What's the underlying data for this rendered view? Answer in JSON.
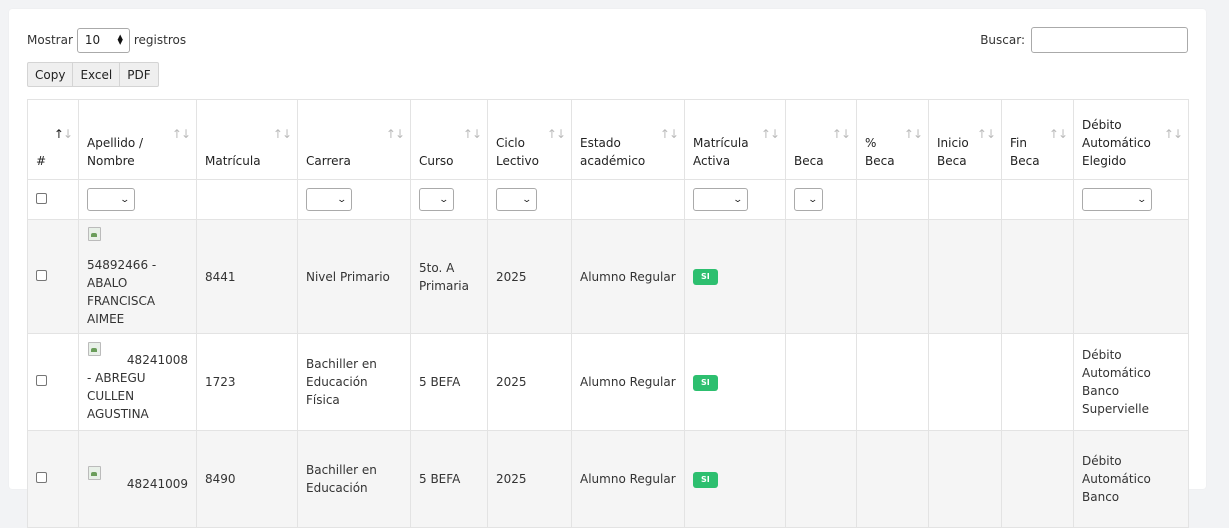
{
  "controls": {
    "show_label": "Mostrar",
    "length_value": "10",
    "records_label": "registros",
    "search_label": "Buscar:",
    "search_value": ""
  },
  "buttons": {
    "copy": "Copy",
    "excel": "Excel",
    "pdf": "PDF"
  },
  "columns": [
    {
      "l1": "",
      "l2": "#"
    },
    {
      "l1": "Apellido /",
      "l2": "Nombre"
    },
    {
      "l1": "",
      "l2": "Matrícula"
    },
    {
      "l1": "",
      "l2": "Carrera"
    },
    {
      "l1": "",
      "l2": "Curso"
    },
    {
      "l1": "Ciclo",
      "l2": "Lectivo"
    },
    {
      "l1": "Estado",
      "l2": "académico"
    },
    {
      "l1": "Matrícula",
      "l2": "Activa"
    },
    {
      "l1": "",
      "l2": "Beca"
    },
    {
      "l1": "%",
      "l2": "Beca"
    },
    {
      "l1": "Inicio",
      "l2": "Beca"
    },
    {
      "l1": "Fin",
      "l2": "Beca"
    },
    {
      "l1": "Débito",
      "l2": "Automático",
      "l3": "Elegido"
    }
  ],
  "rows": [
    {
      "name_l1": "54892466 -",
      "name_l2": "ABALO",
      "name_l3": "FRANCISCA AIMEE",
      "matricula": "8441",
      "carrera_l1": "Nivel Primario",
      "carrera_l2": "",
      "carrera_l3": "",
      "curso_l1": "5to. A",
      "curso_l2": "Primaria",
      "ciclo": "2025",
      "estado": "Alumno Regular",
      "activa": "SI",
      "debito_l1": "",
      "debito_l2": "",
      "debito_l3": "",
      "debito_l4": ""
    },
    {
      "name_l1": "48241008",
      "name_l2": "- ABREGU CULLEN",
      "name_l3": "AGUSTINA",
      "matricula": "1723",
      "carrera_l1": "Bachiller en",
      "carrera_l2": "Educación",
      "carrera_l3": "Física",
      "curso_l1": "5 BEFA",
      "curso_l2": "",
      "ciclo": "2025",
      "estado": "Alumno Regular",
      "activa": "SI",
      "debito_l1": "Débito",
      "debito_l2": "Automático",
      "debito_l3": "Banco",
      "debito_l4": "Supervielle"
    },
    {
      "name_l1": "48241009",
      "name_l2": "",
      "name_l3": "",
      "matricula": "8490",
      "carrera_l1": "Bachiller en",
      "carrera_l2": "Educación",
      "carrera_l3": "",
      "curso_l1": "5 BEFA",
      "curso_l2": "",
      "ciclo": "2025",
      "estado": "Alumno Regular",
      "activa": "SI",
      "debito_l1": "Débito",
      "debito_l2": "Automático",
      "debito_l3": "Banco",
      "debito_l4": ""
    }
  ],
  "colors": {
    "badge": "#2dbf6f",
    "row_striped": "#f5f5f5"
  }
}
